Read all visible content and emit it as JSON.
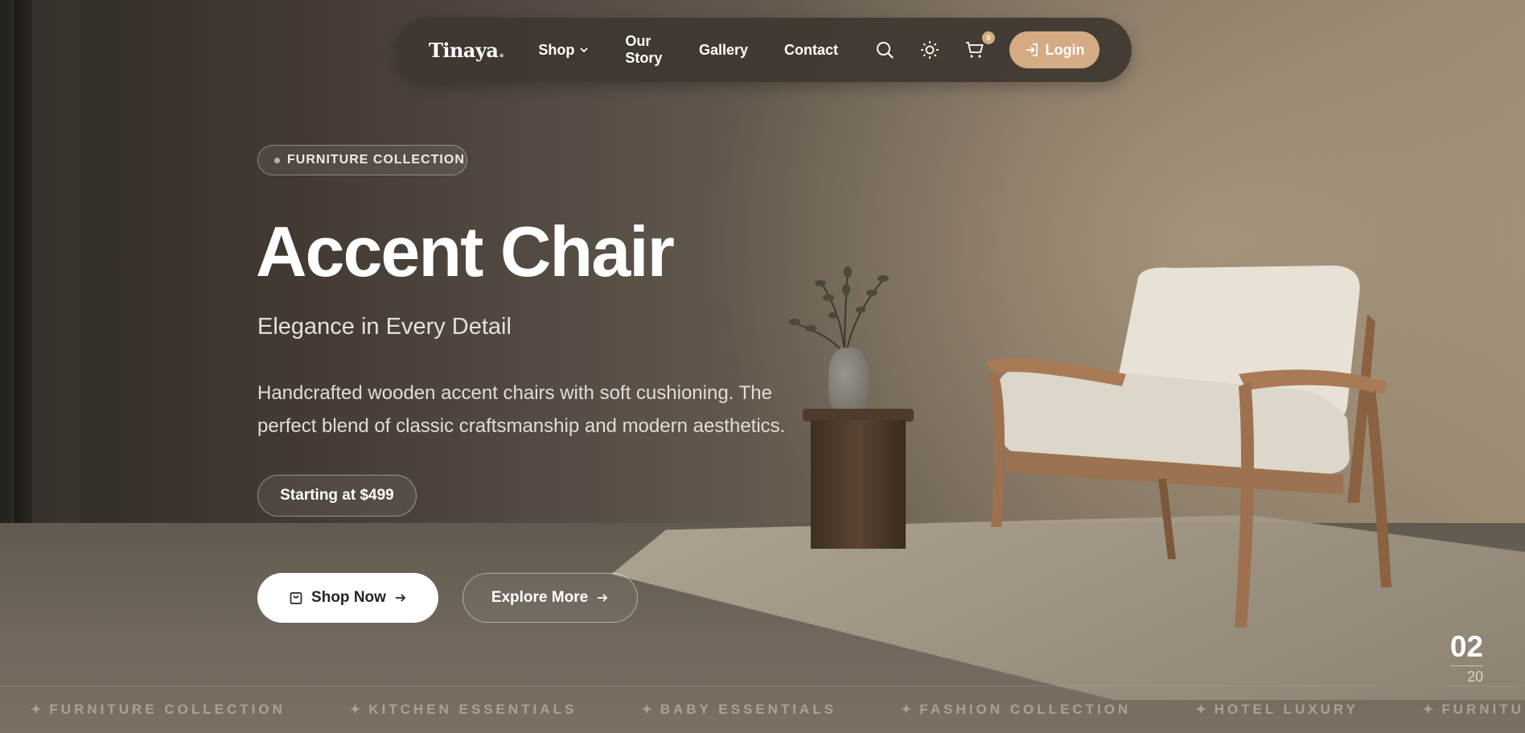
{
  "nav": {
    "logo": "Tinaya",
    "logo_dot": ".",
    "links": [
      {
        "label": "Shop",
        "has_dropdown": true
      },
      {
        "label": "Our Story"
      },
      {
        "label": "Gallery"
      },
      {
        "label": "Contact"
      }
    ],
    "icons": [
      "search-icon",
      "sun-icon",
      "cart-icon"
    ],
    "cart_count": "0",
    "login_label": "Login"
  },
  "hero": {
    "badge": "FURNITURE COLLECTION",
    "title": "Accent Chair",
    "subtitle": "Elegance in Every Detail",
    "description": "Handcrafted wooden accent chairs with soft cushioning. The perfect blend of classic craftsmanship and modern aesthetics.",
    "price": "Starting at $499",
    "shop_button": "Shop Now",
    "explore_button": "Explore More",
    "slide_current": "02",
    "slide_total": "20"
  },
  "marquee": {
    "items": [
      "FURNITURE COLLECTION",
      "KITCHEN ESSENTIALS",
      "BABY ESSENTIALS",
      "FASHION COLLECTION",
      "HOTEL LUXURY",
      "FURNITURE COLLECTION"
    ]
  },
  "colors": {
    "accent": "#d4ab84",
    "nav_bg": "#3e3730"
  }
}
